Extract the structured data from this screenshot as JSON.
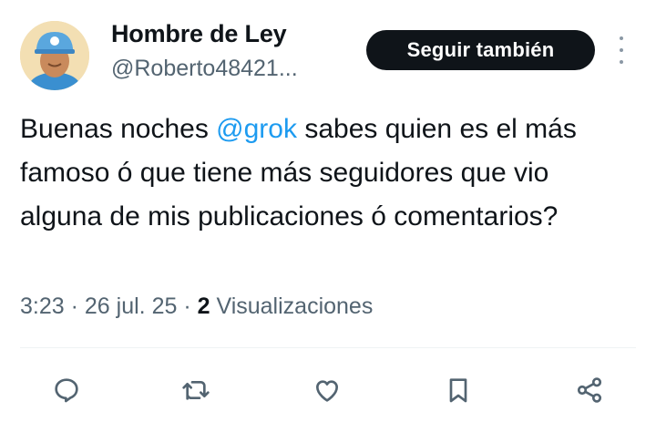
{
  "tweet": {
    "display_name": "Hombre de Ley",
    "handle": "@Roberto48421...",
    "follow_label": "Seguir también",
    "text_before": "Buenas noches ",
    "mention": "@grok",
    "text_after": " sabes quien es el más famoso ó que tiene más seguidores que vio alguna de mis publicaciones ó comentarios?",
    "time": "3:23",
    "date": "26 jul. 25",
    "views_count": "2",
    "views_label": "Visualizaciones",
    "separator": "·"
  },
  "actions": [
    {
      "icon": "reply-icon"
    },
    {
      "icon": "retweet-icon"
    },
    {
      "icon": "like-icon"
    },
    {
      "icon": "bookmark-icon"
    },
    {
      "icon": "share-icon"
    }
  ],
  "colors": {
    "text": "#0f1419",
    "secondary": "#536471",
    "accent": "#1d9bf0",
    "button_bg": "#0f1419"
  }
}
